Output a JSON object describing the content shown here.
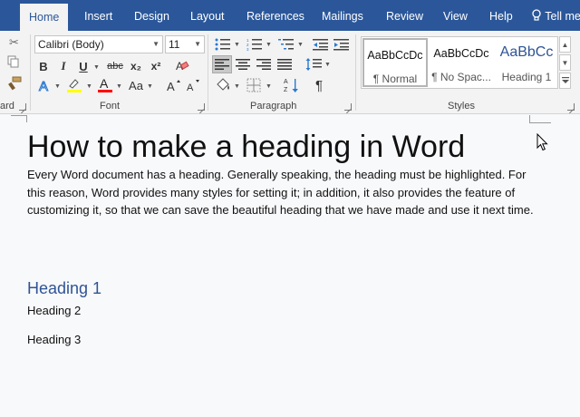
{
  "tabs": [
    "Home",
    "Insert",
    "Design",
    "Layout",
    "References",
    "Mailings",
    "Review",
    "View",
    "Help"
  ],
  "tell_me": "Tell me",
  "groups": {
    "clipboard": "ard",
    "font": "Font",
    "paragraph": "Paragraph",
    "styles": "Styles"
  },
  "font": {
    "name": "Calibri (Body)",
    "size": "11",
    "bold": "B",
    "italic": "I",
    "underline": "U",
    "strike": "abc",
    "subscript": "x₂",
    "superscript": "x²",
    "case": "Aa"
  },
  "styles": [
    {
      "preview": "AaBbCcDc",
      "name": "¶ Normal"
    },
    {
      "preview": "AaBbCcDc",
      "name": "¶ No Spac..."
    },
    {
      "preview": "AaBbCc",
      "name": "Heading 1"
    }
  ],
  "pilcrow": "¶",
  "document": {
    "title": "How to make a heading in Word",
    "body": "Every Word document has a heading. Generally speaking, the heading must be highlighted. For this reason, Word provides many styles for setting it; in addition, it also provides the feature of customizing it, so that we can save the beautiful heading that we have made and use it next time.",
    "heading1": "Heading 1",
    "heading2": "Heading 2",
    "heading3": "Heading 3"
  },
  "colors": {
    "tabbar": "#2b579a",
    "ribbon": "#f3f3f3",
    "heading1": "#2f5496",
    "highlight": "#ffff00",
    "font_color": "#ff0000"
  }
}
